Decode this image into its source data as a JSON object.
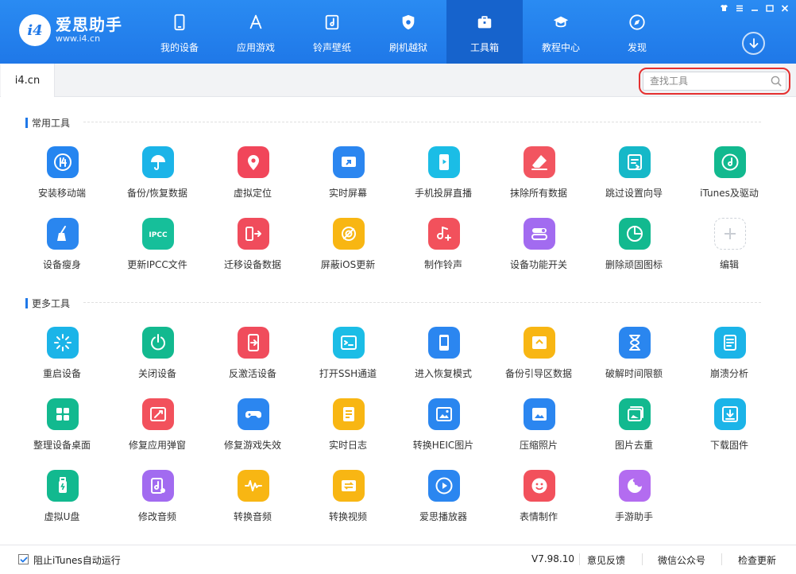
{
  "brand": {
    "title": "爱思助手",
    "subtitle": "www.i4.cn",
    "badge": "i4"
  },
  "nav": [
    {
      "label": "我的设备",
      "icon": "phone-icon"
    },
    {
      "label": "应用游戏",
      "icon": "appstore-icon"
    },
    {
      "label": "铃声壁纸",
      "icon": "music-icon"
    },
    {
      "label": "刷机越狱",
      "icon": "shield-icon"
    },
    {
      "label": "工具箱",
      "icon": "toolbox-icon",
      "active": true
    },
    {
      "label": "教程中心",
      "icon": "graduation-icon"
    },
    {
      "label": "发现",
      "icon": "compass-icon"
    }
  ],
  "tabs": [
    {
      "label": "i4.cn"
    }
  ],
  "search": {
    "placeholder": "查找工具",
    "value": ""
  },
  "sections": [
    {
      "title": "常用工具",
      "tools": [
        {
          "label": "安装移动端",
          "icon": "i4-logo-icon",
          "color": "#2585f0"
        },
        {
          "label": "备份/恢复数据",
          "icon": "umbrella-icon",
          "color": "#1bb4e8"
        },
        {
          "label": "虚拟定位",
          "icon": "location-pin-icon",
          "color": "#f1465a"
        },
        {
          "label": "实时屏幕",
          "icon": "screen-share-icon",
          "color": "#2b86f0"
        },
        {
          "label": "手机投屏直播",
          "icon": "phone-play-icon",
          "color": "#1bbde6"
        },
        {
          "label": "抹除所有数据",
          "icon": "eraser-icon",
          "color": "#f25560"
        },
        {
          "label": "跳过设置向导",
          "icon": "wizard-icon",
          "color": "#15b8c8"
        },
        {
          "label": "iTunes及驱动",
          "icon": "itunes-icon",
          "color": "#12b98f"
        },
        {
          "label": "设备瘦身",
          "icon": "broom-icon",
          "color": "#2a86ef"
        },
        {
          "label": "更新IPCC文件",
          "icon": "ipcc-icon",
          "color": "#16bf9a"
        },
        {
          "label": "迁移设备数据",
          "icon": "migrate-icon",
          "color": "#f04c5c"
        },
        {
          "label": "屏蔽iOS更新",
          "icon": "block-gear-icon",
          "color": "#f8b613"
        },
        {
          "label": "制作铃声",
          "icon": "ringtone-icon",
          "color": "#f2515c"
        },
        {
          "label": "设备功能开关",
          "icon": "toggle-icon",
          "color": "#a26bf0"
        },
        {
          "label": "删除顽固图标",
          "icon": "pie-icon",
          "color": "#12b98f"
        },
        {
          "label": "编辑",
          "icon": "plus-icon",
          "color": "#ffffff",
          "add": true
        }
      ]
    },
    {
      "title": "更多工具",
      "tools": [
        {
          "label": "重启设备",
          "icon": "restart-icon",
          "color": "#1bb4e8"
        },
        {
          "label": "关闭设备",
          "icon": "power-icon",
          "color": "#12b98f"
        },
        {
          "label": "反激活设备",
          "icon": "deactivate-icon",
          "color": "#f04c5c"
        },
        {
          "label": "打开SSH通道",
          "icon": "terminal-icon",
          "color": "#1bbde6"
        },
        {
          "label": "进入恢复模式",
          "icon": "recovery-icon",
          "color": "#2b86f0"
        },
        {
          "label": "备份引导区数据",
          "icon": "backup-boot-icon",
          "color": "#f8b613"
        },
        {
          "label": "破解时间限额",
          "icon": "hourglass-icon",
          "color": "#2a86ef"
        },
        {
          "label": "崩溃分析",
          "icon": "report-icon",
          "color": "#1bb4e8"
        },
        {
          "label": "整理设备桌面",
          "icon": "grid-icon",
          "color": "#12b98f"
        },
        {
          "label": "修复应用弹窗",
          "icon": "repair-icon",
          "color": "#f2515c"
        },
        {
          "label": "修复游戏失效",
          "icon": "gamepad-icon",
          "color": "#2b86f0"
        },
        {
          "label": "实时日志",
          "icon": "log-icon",
          "color": "#f8b613"
        },
        {
          "label": "转换HEIC图片",
          "icon": "heic-icon",
          "color": "#2a86ef"
        },
        {
          "label": "压缩照片",
          "icon": "compress-photo-icon",
          "color": "#2b86f0"
        },
        {
          "label": "图片去重",
          "icon": "dedupe-photo-icon",
          "color": "#12b98f"
        },
        {
          "label": "下载固件",
          "icon": "firmware-download-icon",
          "color": "#1bb4e8"
        },
        {
          "label": "虚拟U盘",
          "icon": "usb-icon",
          "color": "#12b98f"
        },
        {
          "label": "修改音频",
          "icon": "audio-edit-icon",
          "color": "#a26bf0"
        },
        {
          "label": "转换音频",
          "icon": "waveform-icon",
          "color": "#f8b613"
        },
        {
          "label": "转换视频",
          "icon": "video-convert-icon",
          "color": "#f8b613"
        },
        {
          "label": "爱思播放器",
          "icon": "player-icon",
          "color": "#2b86f0"
        },
        {
          "label": "表情制作",
          "icon": "emoji-icon",
          "color": "#f2515c"
        },
        {
          "label": "手游助手",
          "icon": "game-assistant-icon",
          "color": "#b36cf0"
        }
      ]
    }
  ],
  "footer": {
    "checkbox_label": "阻止iTunes自动运行",
    "checked": true,
    "version": "V7.98.10",
    "feedback": "意见反馈",
    "wechat": "微信公众号",
    "update": "检查更新"
  }
}
